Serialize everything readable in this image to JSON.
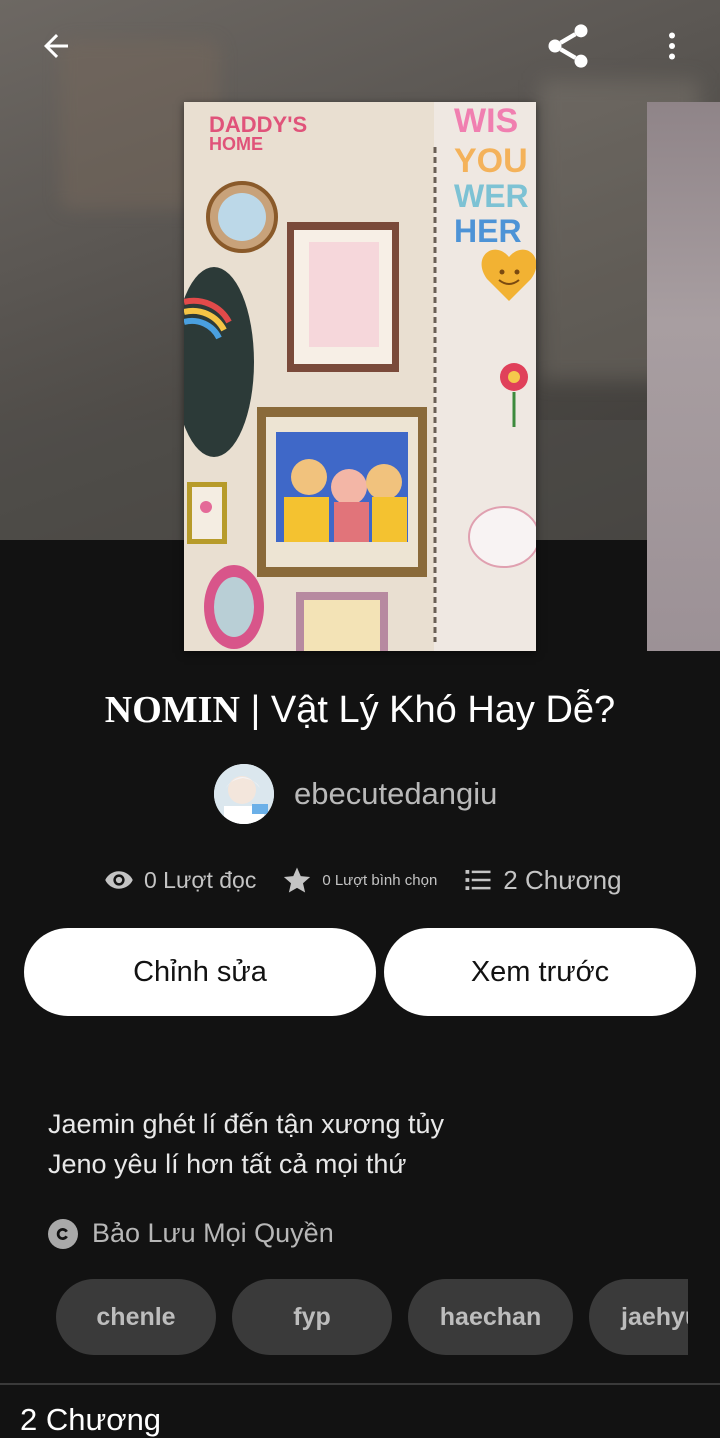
{
  "toolbar": {
    "back_icon": "arrow-left-icon",
    "share_icon": "share-icon",
    "more_icon": "more-vertical-icon"
  },
  "cover": {
    "art_text": "DADDY'S HOME"
  },
  "story": {
    "title_serif": "NOMIN",
    "title_rest": " | Vật Lý Khó Hay Dễ?",
    "author": "ebecutedangiu",
    "stats": {
      "reads": "0 Lượt đọc",
      "votes": "0 Lượt bình chọn",
      "parts": "2 Chương"
    },
    "actions": {
      "edit": "Chỉnh sửa",
      "preview": "Xem trước"
    },
    "description": [
      "Jaemin ghét lí đến tận xương tủy",
      "Jeno yêu lí hơn tất cả mọi thứ"
    ],
    "copyright": "Bảo Lưu Mọi Quyền",
    "tags": [
      "chenle",
      "fyp",
      "haechan",
      "jaehyun"
    ],
    "chapters_heading": "2 Chương"
  },
  "colors": {
    "background": "#121212",
    "button": "#ffffff",
    "tag_bg": "#3a3a3a"
  }
}
